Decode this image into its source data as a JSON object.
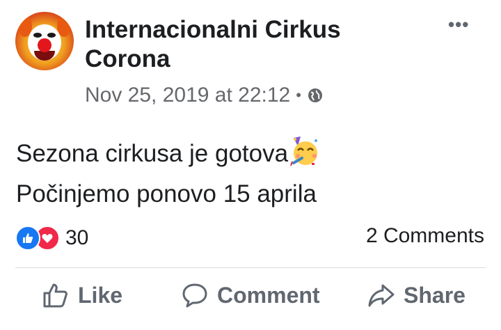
{
  "post": {
    "author": "Internacionalni Cirkus Corona",
    "timestamp": "Nov 25, 2019 at 22:12",
    "separator": "•",
    "privacy_icon": "globe-icon",
    "menu_icon": "more-options-icon",
    "text_line1": "Sezona cirkusa je gotova",
    "text_emoji": "partying-face-emoji",
    "text_line2": "Počinjemo ponovo 15 aprila"
  },
  "stats": {
    "reaction_icons": [
      "like-reaction-icon",
      "love-reaction-icon"
    ],
    "reaction_count": "30",
    "comments": "2 Comments"
  },
  "actions": {
    "like": "Like",
    "comment": "Comment",
    "share": "Share"
  },
  "colors": {
    "like_blue": "#1877f2",
    "love_red": "#f02849",
    "secondary_text": "#65676b",
    "action_gray": "#606770"
  }
}
